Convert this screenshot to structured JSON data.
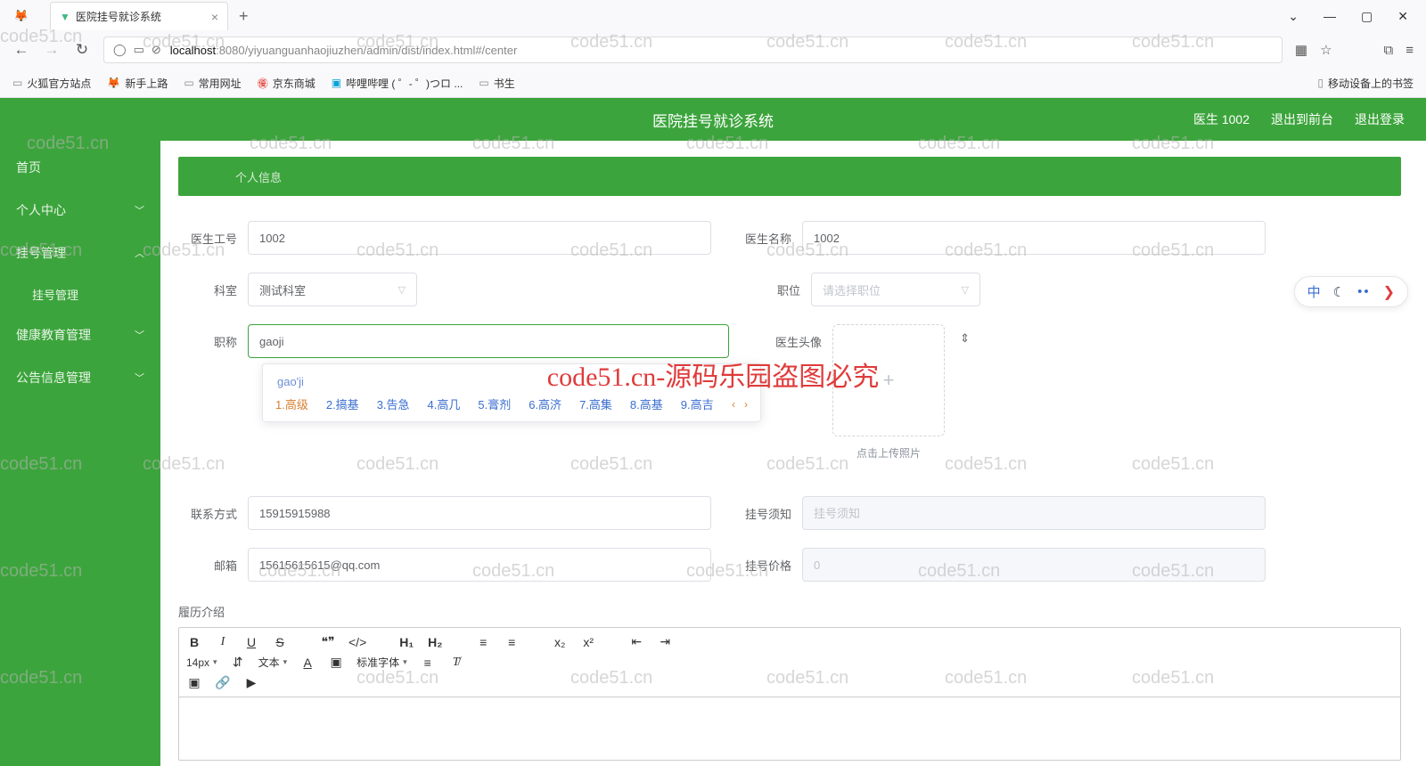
{
  "browser": {
    "tab_title": "医院挂号就诊系统",
    "url_prefix": "localhost",
    "url_rest": ":8080/yiyuanguanhaojiuzhen/admin/dist/index.html#/center",
    "bookmarks": [
      "火狐官方站点",
      "新手上路",
      "常用网址",
      "京东商城",
      "哔哩哔哩 ( ゜- ゜)つロ ...",
      "书生"
    ],
    "mobile_bmk": "移动设备上的书签"
  },
  "header": {
    "title": "医院挂号就诊系统",
    "user": "医生 1002",
    "back": "退出到前台",
    "logout": "退出登录"
  },
  "sidebar": {
    "items": [
      {
        "label": "首页",
        "expand": ""
      },
      {
        "label": "个人中心",
        "expand": "﹀"
      },
      {
        "label": "挂号管理",
        "expand": "︿",
        "sub": "挂号管理"
      },
      {
        "label": "健康教育管理",
        "expand": "﹀"
      },
      {
        "label": "公告信息管理",
        "expand": "﹀"
      }
    ]
  },
  "crumb": "个人信息",
  "form": {
    "doctor_id_label": "医生工号",
    "doctor_id": "1002",
    "doctor_name_label": "医生名称",
    "doctor_name": "1002",
    "dept_label": "科室",
    "dept_value": "测试科室",
    "position_label": "职位",
    "position_placeholder": "请选择职位",
    "title_label": "职称",
    "title_value": "gaoji",
    "avatar_label": "医生头像",
    "avatar_hint": "点击上传照片",
    "contact_label": "联系方式",
    "contact": "15915915988",
    "notice_label": "挂号须知",
    "notice_placeholder": "挂号须知",
    "email_label": "邮箱",
    "email": "15615615615@qq.com",
    "price_label": "挂号价格",
    "price_placeholder": "0",
    "resume_label": "履历介绍"
  },
  "ime": {
    "typed": "gao'ji",
    "candidates": [
      "1.高级",
      "2.搞基",
      "3.告急",
      "4.高几",
      "5.膏剂",
      "6.高济",
      "7.高集",
      "8.高基",
      "9.高吉"
    ]
  },
  "editor": {
    "font_size": "14px",
    "para": "文本",
    "font_family": "标准字体"
  },
  "float_tools": {
    "cn": "中"
  },
  "watermark_main": "code51.cn-源码乐园盗图必究",
  "wm_small": "code51.cn"
}
